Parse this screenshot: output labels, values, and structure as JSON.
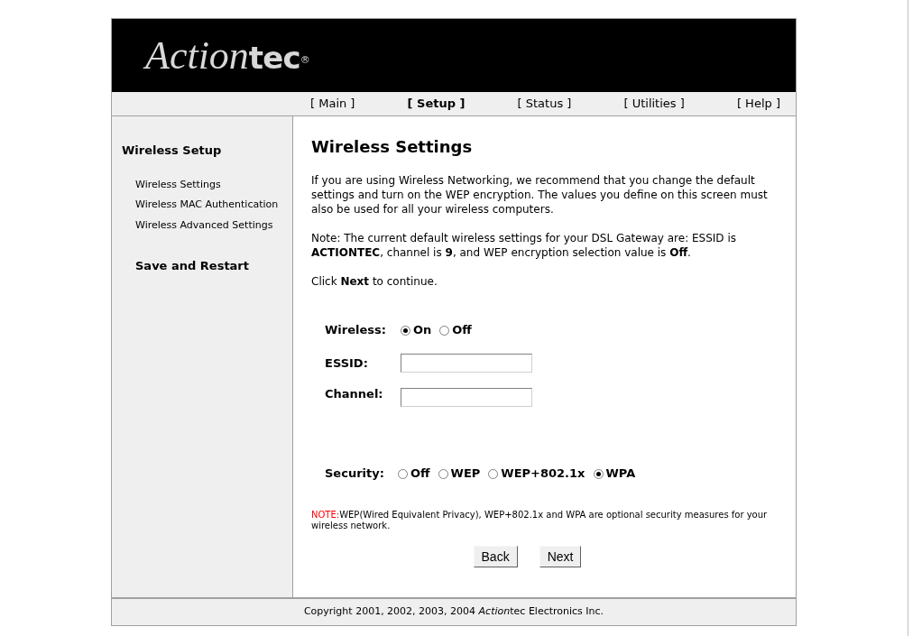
{
  "logo": {
    "script": "Action",
    "rest": "tec",
    "mark": "®"
  },
  "nav": [
    {
      "label": "[ Main ]",
      "selected": false
    },
    {
      "label": "[ Setup ]",
      "selected": true
    },
    {
      "label": "[ Status ]",
      "selected": false
    },
    {
      "label": "[ Utilities ]",
      "selected": false
    },
    {
      "label": "[ Help ]",
      "selected": false
    }
  ],
  "sidebar": {
    "heading": "Wireless Setup",
    "items": [
      "Wireless Settings",
      "Wireless MAC Authentication",
      "Wireless Advanced Settings"
    ],
    "action": "Save and Restart"
  },
  "page_title": "Wireless Settings",
  "paragraphs": [
    "If you are using Wireless Networking, we recommend that you change the default settings and turn on the WEP encryption. The values you define on this screen must also be used for all your wireless computers.",
    "Note: The current default wireless settings for your DSL Gateway are: ESSID is **ACTIONTEC**, channel is **9**, and WEP encryption selection value is **Off**.",
    "Click **Next** to continue."
  ],
  "wireless": {
    "label": "Wireless:",
    "options": [
      {
        "label": "On",
        "selected": true
      },
      {
        "label": "Off",
        "selected": false
      }
    ]
  },
  "essid": {
    "label": "ESSID:"
  },
  "channel": {
    "label": "Channel:"
  },
  "security": {
    "label": "Security:",
    "options": [
      {
        "label": "Off",
        "selected": false
      },
      {
        "label": "WEP",
        "selected": false
      },
      {
        "label": "WEP+802.1x",
        "selected": false
      },
      {
        "label": "WPA",
        "selected": true
      }
    ]
  },
  "note": {
    "label": "NOTE:",
    "text": "WEP(Wired Equivalent Privacy), WEP+802.1x and WPA are optional security measures for your wireless network."
  },
  "buttons": [
    "Back",
    "Next"
  ],
  "footer": {
    "before": "Copyright 2001, 2002, 2003, 2004",
    "brand_script": "Action",
    "after": "tec Electronics Inc."
  }
}
